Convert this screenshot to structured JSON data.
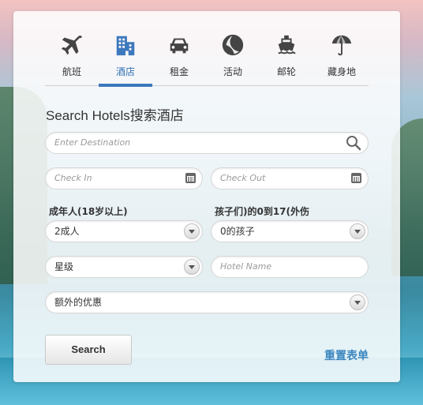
{
  "tabs": [
    {
      "label": "航班",
      "icon": "airplane-icon"
    },
    {
      "label": "酒店",
      "icon": "hotel-building-icon",
      "active": true
    },
    {
      "label": "租金",
      "icon": "car-icon"
    },
    {
      "label": "活动",
      "icon": "beach-ball-icon"
    },
    {
      "label": "邮轮",
      "icon": "cruise-ship-icon"
    },
    {
      "label": "藏身地",
      "icon": "beach-umbrella-icon"
    }
  ],
  "form": {
    "title": "Search Hotels搜索酒店",
    "destination_placeholder": "Enter Destination",
    "checkin_placeholder": "Check In",
    "checkout_placeholder": "Check Out",
    "adults_label": "成年人(18岁以上)",
    "children_label": "孩子们)的0到17(外伤",
    "adults_value": "2成人",
    "children_value": "0的孩子",
    "stars_value": "星级",
    "hotel_name_placeholder": "Hotel Name",
    "extras_value": "额外的优惠",
    "search_button": "Search",
    "reset_link": "重置表单"
  },
  "colors": {
    "accent": "#3c78bd",
    "reset_link": "#3b86bf"
  }
}
